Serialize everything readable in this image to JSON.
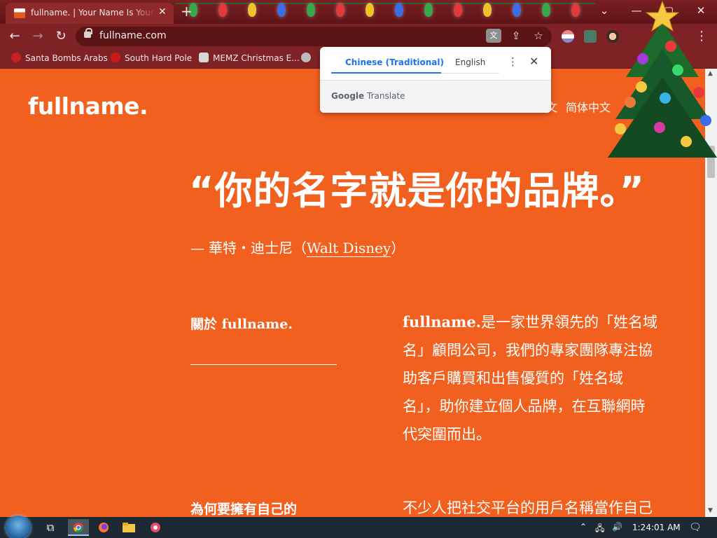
{
  "browser": {
    "tab_title": "fullname. | Your Name Is Your Brand",
    "tab_close": "✕",
    "new_tab": "+",
    "url": "fullname.com",
    "window_controls": {
      "dropdown": "⌄",
      "minimize": "—",
      "maximize": "▢",
      "close": "✕"
    },
    "nav": {
      "back": "←",
      "forward": "→",
      "reload": "↻"
    },
    "omnibox_icons": {
      "translate": "文",
      "share": "⇪",
      "star": "☆"
    },
    "menu": "⋮"
  },
  "bookmarks": [
    {
      "label": "Santa Bombs Arabs",
      "icon": "santa-icon",
      "color": "#c92020"
    },
    {
      "label": "South Hard Pole",
      "icon": "snowflake-icon",
      "color": "#cc1a1a"
    },
    {
      "label": "MEMZ Christmas E...",
      "icon": "memz-icon",
      "color": "#d7d7d7"
    },
    {
      "label": "",
      "icon": "raccoon-icon",
      "color": "#bbbbbb"
    }
  ],
  "translate_popup": {
    "source_tab": "Chinese (Traditional)",
    "target_tab": "English",
    "more": "⋮",
    "close": "✕",
    "brand_google": "Google",
    "brand_translate": "Translate"
  },
  "page": {
    "logo": "fullname.",
    "lang_partial": "文",
    "lang_simplified": "简体中文",
    "quote": "“你的名字就是你的品牌。”",
    "attribution_dash": "—",
    "attribution_name": "華特・迪士尼（",
    "attribution_link": "Walt Disney",
    "attribution_close": "）",
    "about_title": "關於 fullname.",
    "about_body_brand": "fullname.",
    "about_body_lines": [
      "是一家世界領先的「姓名域",
      "名」顧問公司，我們的專家團隊專注協",
      "助客戶購買和出售優質的「姓名域",
      "名」，助你建立個人品牌，在互聯網時",
      "代突圍而出。"
    ],
    "why_title": "為何要擁有自己的",
    "why_body": "不少人把社交平台的用戶名稱當作自己"
  },
  "taskbar": {
    "clock": "1:24:01 AM",
    "tray_chevron": "⌃",
    "tray_network": "🖧",
    "tray_volume": "🔊",
    "notification": "🗨"
  },
  "colors": {
    "page_bg": "#f2601f",
    "chrome_bg": "#7e2225",
    "accent_blue": "#1a73e8"
  }
}
